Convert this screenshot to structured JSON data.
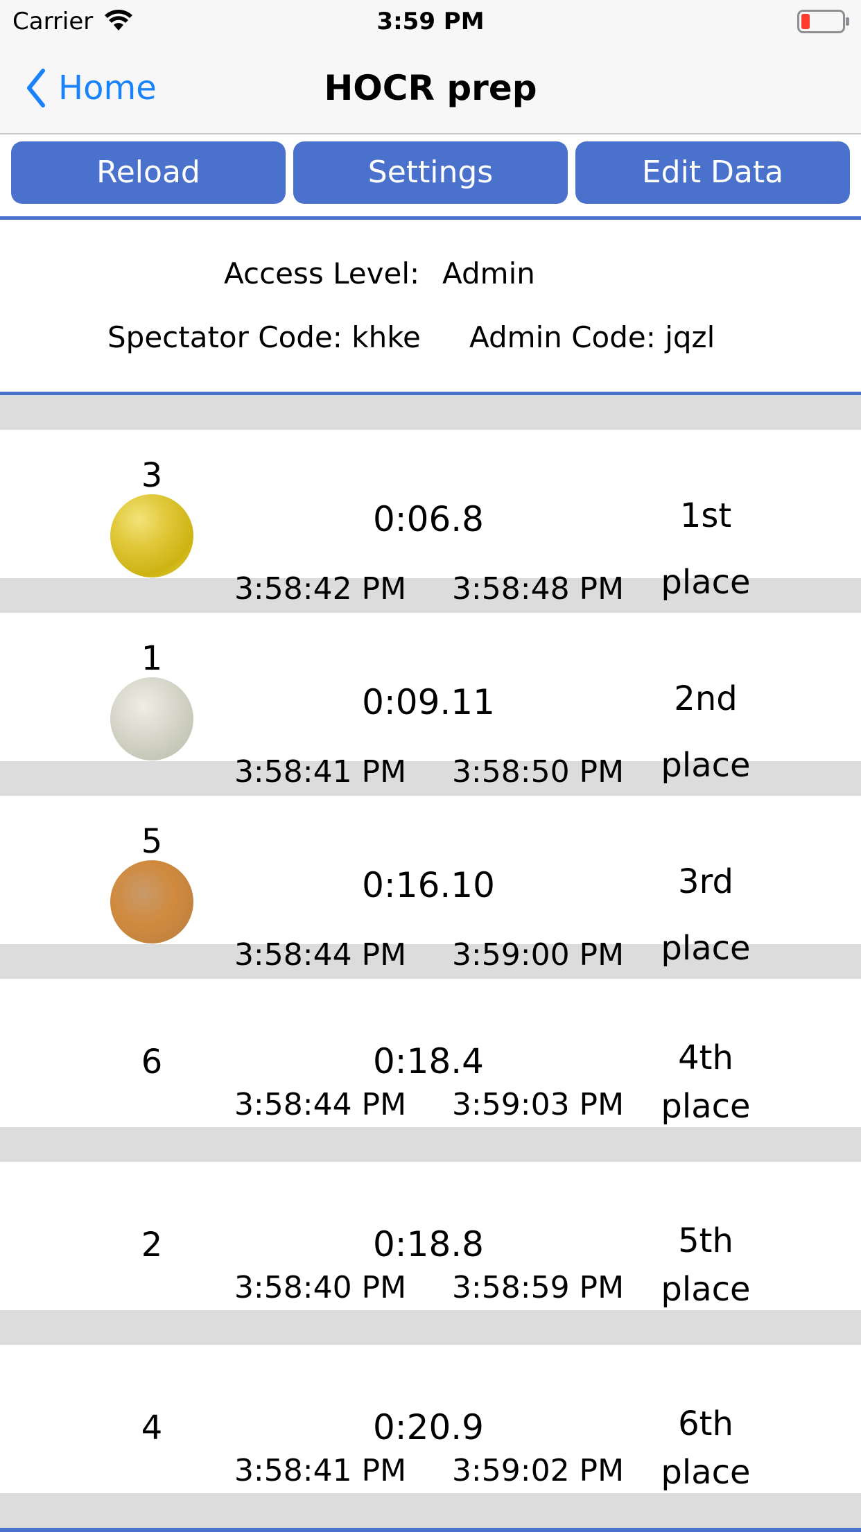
{
  "status_bar": {
    "carrier": "Carrier",
    "time": "3:59 PM",
    "wifi_icon": "wifi-icon",
    "battery_icon": "battery-low-icon"
  },
  "nav": {
    "back_label": "Home",
    "title": "HOCR prep"
  },
  "toolbar": {
    "reload_label": "Reload",
    "settings_label": "Settings",
    "edit_label": "Edit Data"
  },
  "info": {
    "access_level_label": "Access Level:",
    "access_level_value": "Admin",
    "spectator_code": "Spectator Code: khke",
    "admin_code": "Admin Code: jqzl"
  },
  "results": [
    {
      "lane": "3",
      "medal": "gold",
      "elapsed": "0:06.8",
      "start": "3:58:42 PM",
      "finish": "3:58:48 PM",
      "place": "1st",
      "place_word": "place"
    },
    {
      "lane": "1",
      "medal": "silver",
      "elapsed": "0:09.11",
      "start": "3:58:41 PM",
      "finish": "3:58:50 PM",
      "place": "2nd",
      "place_word": "place"
    },
    {
      "lane": "5",
      "medal": "bronze",
      "elapsed": "0:16.10",
      "start": "3:58:44 PM",
      "finish": "3:59:00 PM",
      "place": "3rd",
      "place_word": "place"
    },
    {
      "lane": "6",
      "medal": "",
      "elapsed": "0:18.4",
      "start": "3:58:44 PM",
      "finish": "3:59:03 PM",
      "place": "4th",
      "place_word": "place"
    },
    {
      "lane": "2",
      "medal": "",
      "elapsed": "0:18.8",
      "start": "3:58:40 PM",
      "finish": "3:58:59 PM",
      "place": "5th",
      "place_word": "place"
    },
    {
      "lane": "4",
      "medal": "",
      "elapsed": "0:20.9",
      "start": "3:58:41 PM",
      "finish": "3:59:02 PM",
      "place": "6th",
      "place_word": "place"
    }
  ],
  "colors": {
    "accent": "#4a72cc",
    "link": "#1a82fb",
    "separator": "#dcdcdc",
    "battery_low": "#ff3b30"
  }
}
